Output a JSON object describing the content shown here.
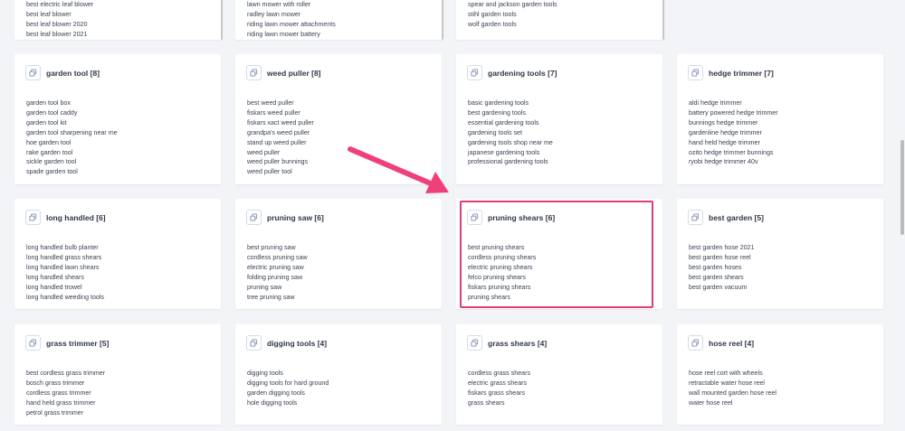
{
  "top_cards": [
    {
      "keywords": [
        "best electric leaf blower",
        "best leaf blower",
        "best leaf blower 2020",
        "best leaf blower 2021"
      ]
    },
    {
      "keywords": [
        "lawn mower with roller",
        "radley lawn mower",
        "riding lawn mower attachments",
        "riding lawn mower battery"
      ]
    },
    {
      "keywords": [
        "spear and jackson garden tools",
        "stihl garden tools",
        "wolf garden tools"
      ]
    }
  ],
  "cards": [
    {
      "title": "garden tool [8]",
      "keywords": [
        "garden tool box",
        "garden tool caddy",
        "garden tool kit",
        "garden tool sharpening near me",
        "hoe garden tool",
        "rake garden tool",
        "sickle garden tool",
        "spade garden tool"
      ]
    },
    {
      "title": "weed puller [8]",
      "keywords": [
        "best weed puller",
        "fiskars weed puller",
        "fiskars xact weed puller",
        "grandpa's weed puller",
        "stand up weed puller",
        "weed puller",
        "weed puller bunnings",
        "weed puller tool"
      ]
    },
    {
      "title": "gardening tools [7]",
      "keywords": [
        "basic gardening tools",
        "best gardening tools",
        "essential gardening tools",
        "gardening tools set",
        "gardening tools shop near me",
        "japanese gardening tools",
        "professional gardening tools"
      ]
    },
    {
      "title": "hedge trimmer [7]",
      "keywords": [
        "aldi hedge trimmer",
        "battery powered hedge trimmer",
        "bunnings hedge trimmer",
        "gardenline hedge trimmer",
        "hand held hedge trimmer",
        "ozito hedge trimmer bunnings",
        "ryobi hedge trimmer 40v"
      ]
    },
    {
      "title": "long handled [6]",
      "keywords": [
        "long handled bulb planter",
        "long handled grass shears",
        "long handled lawn shears",
        "long handled shears",
        "long handled trowel",
        "long handled weeding tools"
      ]
    },
    {
      "title": "pruning saw [6]",
      "keywords": [
        "best pruning saw",
        "cordless pruning saw",
        "electric pruning saw",
        "folding pruning saw",
        "pruning saw",
        "tree pruning saw"
      ]
    },
    {
      "title": "pruning shears [6]",
      "keywords": [
        "best pruning shears",
        "cordless pruning shears",
        "electric pruning shears",
        "felco pruning shears",
        "fiskars pruning shears",
        "pruning shears"
      ]
    },
    {
      "title": "best garden [5]",
      "keywords": [
        "best garden hose 2021",
        "best garden hose reel",
        "best garden hoses",
        "best garden shears",
        "best garden vacuum"
      ]
    },
    {
      "title": "grass trimmer [5]",
      "keywords": [
        "best cordless grass trimmer",
        "bosch grass trimmer",
        "cordless grass trimmer",
        "hand held grass trimmer",
        "petrol grass trimmer"
      ]
    },
    {
      "title": "digging tools [4]",
      "keywords": [
        "digging tools",
        "digging tools for hard ground",
        "garden digging tools",
        "hole digging tools"
      ]
    },
    {
      "title": "grass shears [4]",
      "keywords": [
        "cordless grass shears",
        "electric grass shears",
        "fiskars grass shears",
        "grass shears"
      ]
    },
    {
      "title": "hose reel [4]",
      "keywords": [
        "hose reel cort with wheels",
        "retractable water hose reel",
        "wall mounted garden hose reel",
        "water hose reel"
      ]
    }
  ],
  "colors": {
    "highlight": "#e63a74",
    "arrow": "#f0407a",
    "title": "#2f3748",
    "text": "#3a4254"
  },
  "icons": {
    "card_icon": "copy-icon"
  }
}
